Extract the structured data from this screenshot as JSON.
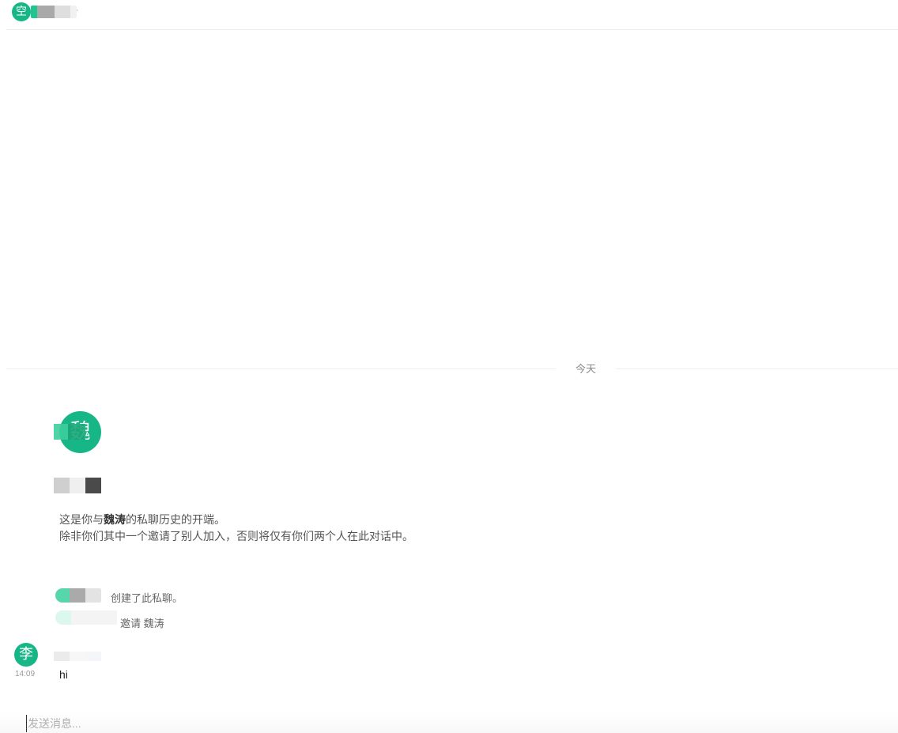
{
  "header": {
    "avatar_initial": "空",
    "trailing_mark": "·"
  },
  "timeline": {
    "day_divider": "今天"
  },
  "intro": {
    "avatar_initial": "魏",
    "line1_prefix": "这是你与",
    "line1_name": "魏涛",
    "line1_suffix": "的私聊历史的开端。",
    "line2": "除非你们其中一个邀请了别人加入，否则将仅有你们两个人在此对话中。"
  },
  "events": [
    {
      "text": "创建了此私聊。"
    },
    {
      "text": "邀请 魏涛"
    }
  ],
  "message": {
    "avatar_initial": "李",
    "time": "14:09",
    "body": "hi"
  },
  "composer": {
    "placeholder": "发送消息..."
  },
  "colors": {
    "avatar_green": "#17b686",
    "divider": "#eeeeee"
  }
}
